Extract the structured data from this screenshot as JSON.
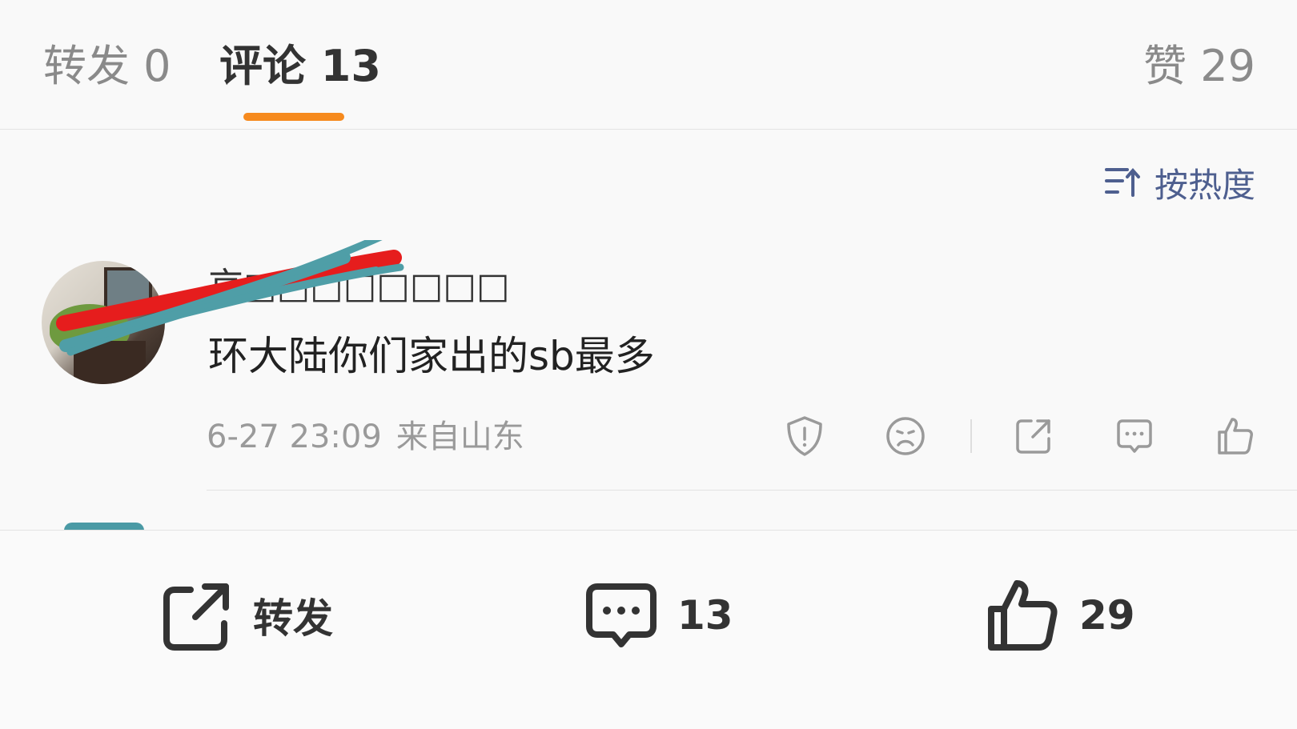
{
  "tabs": {
    "repost": "转发 0",
    "comments": "评论 13",
    "likes": "赞 29",
    "active": "comments",
    "accent_color": "#f68a1e"
  },
  "sort": {
    "label": "按热度",
    "icon": "sort-ascending-icon"
  },
  "comment": {
    "author": "京□□□□□□□□",
    "text": "环大陆你们家出的sb最多",
    "date": "6-27 23:09",
    "location": "来自山东",
    "actions": [
      "report-icon",
      "dislike-icon",
      "share-icon",
      "reply-icon",
      "like-icon"
    ]
  },
  "bottom_bar": {
    "repost_label": "转发",
    "comment_count": "13",
    "like_count": "29"
  }
}
